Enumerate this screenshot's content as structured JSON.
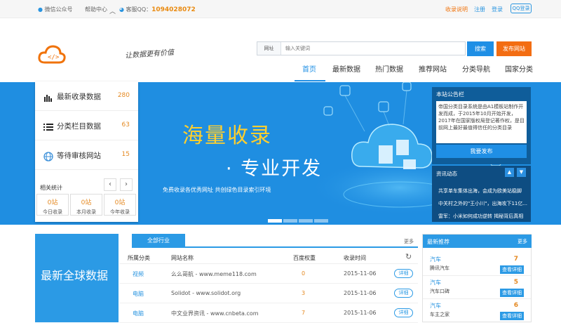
{
  "topbar": {
    "wechat": "微信公众号",
    "help": "帮助中心",
    "service_label": "客服QQ：",
    "service_qq": "1094028072",
    "links": [
      "收录说明",
      "注册",
      "登录"
    ],
    "qq_login": "QQ登录"
  },
  "header": {
    "slogan": "让数据更有价值",
    "search": {
      "label": "网址",
      "placeholder": "输入关键词",
      "button": "搜索"
    },
    "publish_button": "发布网站",
    "nav": [
      "首页",
      "最新数据",
      "热门数据",
      "推荐网站",
      "分类导航",
      "国家分类"
    ]
  },
  "sidebar": {
    "items": [
      {
        "label": "最新收录数据",
        "count": "280",
        "icon": "bar-chart-icon"
      },
      {
        "label": "分类栏目数据",
        "count": "63",
        "icon": "list-icon"
      },
      {
        "label": "等待审核网站",
        "count": "15",
        "icon": "globe-icon"
      }
    ],
    "stats_title": "相关统计",
    "counters": [
      {
        "value": "0站",
        "label": "今日收录"
      },
      {
        "value": "0站",
        "label": "本月收录"
      },
      {
        "value": "0站",
        "label": "今年收录"
      }
    ]
  },
  "banner": {
    "title1": "海量收录",
    "title2": "· 专业开发",
    "subtitle": "免费收录各优秀网址   共创绿色目录索引环境",
    "colors": {
      "bg": "#1f8ee1",
      "accent": "#ffcf2e"
    }
  },
  "notice": {
    "title": "本站公告栏",
    "text": "帝国分类目录系统是由A1模板站制作开发而成，于2015年10月开始开发，2017年在国家版权局登记著作权，是目前网上最好最值得信任的分类目录",
    "button": "我要发布"
  },
  "news": {
    "title": "资讯动态",
    "items": [
      "共享单车集体出海，会成为欧美站稳脚",
      "中关村之外的\"王小川\"，出海攻下11亿...",
      "雷军：小米如何成功逆转 揭秘背后真相"
    ]
  },
  "global": {
    "title": "最新全球数据"
  },
  "table": {
    "tab": "全部行业",
    "more": "更多",
    "headers": [
      "所属分类",
      "网站名称",
      "百度权重",
      "收录时间"
    ],
    "rows": [
      {
        "cat": "视频",
        "name": "么么哥航 - www.meme118.com",
        "weight": "0",
        "date": "2015-11-06",
        "btn": "详细"
      },
      {
        "cat": "电脑",
        "name": "Solidot - www.solidot.org",
        "weight": "3",
        "date": "2015-11-06",
        "btn": "详细"
      },
      {
        "cat": "电脑",
        "name": "中文业界资讯 - www.cnbeta.com",
        "weight": "7",
        "date": "2015-11-06",
        "btn": "详细"
      }
    ]
  },
  "recommend": {
    "title": "最新推荐",
    "more": "更多",
    "items": [
      {
        "cat": "汽车",
        "name": "腾讯汽车",
        "num": "7",
        "btn": "查看详细"
      },
      {
        "cat": "汽车",
        "name": "汽车口碑",
        "num": "5",
        "btn": "查看详细"
      },
      {
        "cat": "汽车",
        "name": "车主之家",
        "num": "6",
        "btn": "查看详细"
      }
    ]
  }
}
